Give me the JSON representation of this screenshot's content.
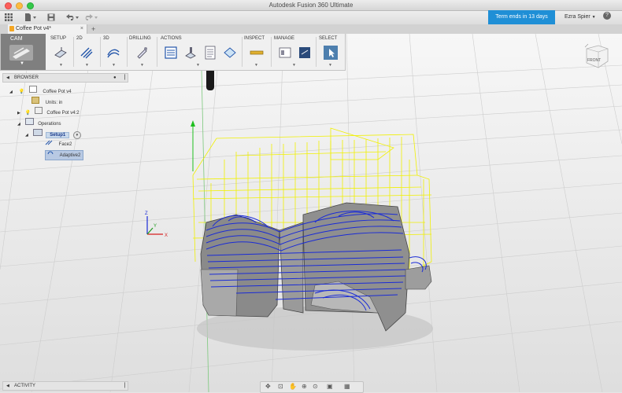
{
  "window": {
    "title": "Autodesk Fusion 360 Ultimate"
  },
  "account": {
    "trial": "Term ends in 13 days",
    "user": "Ezra Spier",
    "help": "?"
  },
  "tab": {
    "title": "Coffee Pot v4*",
    "close": "×",
    "add": "+"
  },
  "ribbon": {
    "workspace": "CAM",
    "groups": [
      "SETUP",
      "2D",
      "3D",
      "DRILLING",
      "ACTIONS",
      "INSPECT",
      "MANAGE",
      "SELECT"
    ]
  },
  "browser": {
    "header": "BROWSER",
    "root": "Coffee Pot v4",
    "units": "Units: in",
    "component": "Coffee Pot v4:2",
    "operations": "Operations",
    "setup": "Setup1",
    "op_face": "Face2",
    "op_adaptive": "Adaptive2"
  },
  "activity": {
    "label": "ACTIVITY"
  },
  "viewcube": {
    "face": "FRONT"
  },
  "colors": {
    "accent": "#1f8fd6",
    "toolpath_yellow": "#f0f000",
    "toolpath_blue": "#1a2bd6",
    "cam_tab": "#7f7f7f"
  },
  "icons": [
    "grid-icon",
    "file-icon",
    "save-icon",
    "undo-icon",
    "redo-icon",
    "help-icon",
    "eye-icon",
    "lightbulb-icon"
  ]
}
